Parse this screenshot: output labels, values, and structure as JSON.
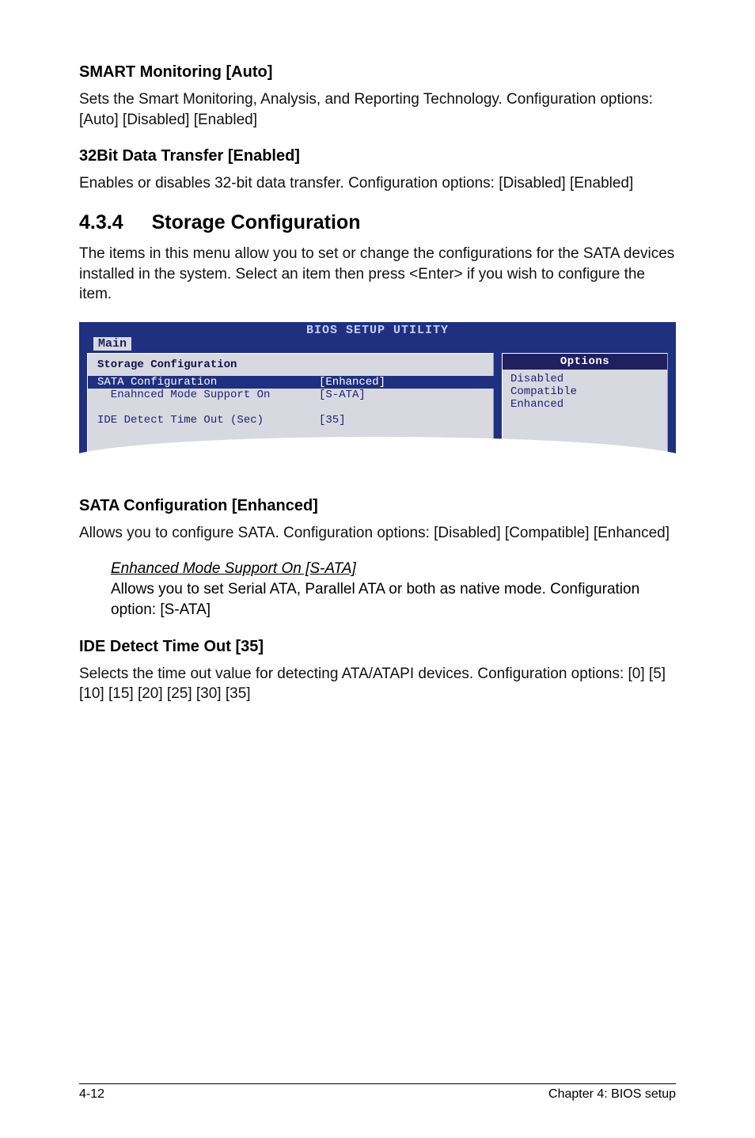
{
  "smart": {
    "heading": "SMART Monitoring [Auto]",
    "body": "Sets the Smart Monitoring, Analysis, and Reporting Technology. Configuration options: [Auto] [Disabled] [Enabled]"
  },
  "data32": {
    "heading": "32Bit Data Transfer [Enabled]",
    "body": "Enables or disables 32-bit data transfer. Configuration options: [Disabled] [Enabled]"
  },
  "section": {
    "number": "4.3.4",
    "title": "Storage Configuration",
    "intro": "The items in this menu allow you to set or change the configurations for the SATA devices installed in the system. Select an item then press <Enter> if you wish to configure the item."
  },
  "bios": {
    "utility_title": "BIOS SETUP UTILITY",
    "tab": "Main",
    "left_title": "Storage Configuration",
    "rows": [
      {
        "label": "SATA Configuration",
        "value": "[Enhanced]",
        "selected": true
      },
      {
        "label": "  Enahnced Mode Support On",
        "value": "[S-ATA]",
        "selected": false
      },
      {
        "label": "",
        "value": "",
        "selected": false
      },
      {
        "label": "IDE Detect Time Out (Sec)",
        "value": "[35]",
        "selected": false
      }
    ],
    "right_title": "Options",
    "right_items": [
      "Disabled",
      "Compatible",
      "Enhanced"
    ]
  },
  "sata": {
    "heading": "SATA Configuration [Enhanced]",
    "body": "Allows you to configure SATA. Configuration options: [Disabled] [Compatible] [Enhanced]",
    "sub_title": "Enhanced Mode Support On [S-ATA]",
    "sub_body": "Allows you to set Serial ATA, Parallel ATA or both as native mode. Configuration option: [S-ATA]"
  },
  "ide": {
    "heading": "IDE Detect Time Out [35]",
    "body": "Selects the time out value for detecting ATA/ATAPI devices. Configuration options: [0] [5] [10] [15] [20] [25] [30] [35]"
  },
  "footer": {
    "left": "4-12",
    "right": "Chapter 4: BIOS setup"
  }
}
